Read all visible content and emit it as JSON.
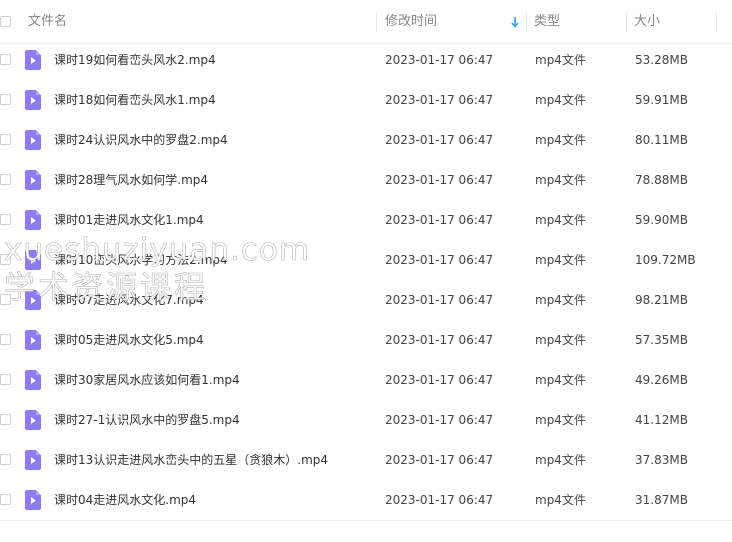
{
  "header": {
    "name_label": "文件名",
    "date_label": "修改时间",
    "type_label": "类型",
    "size_label": "大小",
    "sort_icon": "sort-down-arrow-icon"
  },
  "files": [
    {
      "name": "课时19如何看峦头风水2.mp4",
      "date": "2023-01-17 06:47",
      "type": "mp4文件",
      "size": "53.28MB"
    },
    {
      "name": "课时18如何看峦头风水1.mp4",
      "date": "2023-01-17 06:47",
      "type": "mp4文件",
      "size": "59.91MB"
    },
    {
      "name": "课时24认识风水中的罗盘2.mp4",
      "date": "2023-01-17 06:47",
      "type": "mp4文件",
      "size": "80.11MB"
    },
    {
      "name": "课时28理气风水如何学.mp4",
      "date": "2023-01-17 06:47",
      "type": "mp4文件",
      "size": "78.88MB"
    },
    {
      "name": "课时01走进风水文化1.mp4",
      "date": "2023-01-17 06:47",
      "type": "mp4文件",
      "size": "59.90MB"
    },
    {
      "name": "课时10峦头风水学习方法2.mp4",
      "date": "2023-01-17 06:47",
      "type": "mp4文件",
      "size": "109.72MB"
    },
    {
      "name": "课时07走进风水文化7.mp4",
      "date": "2023-01-17 06:47",
      "type": "mp4文件",
      "size": "98.21MB"
    },
    {
      "name": "课时05走进风水文化5.mp4",
      "date": "2023-01-17 06:47",
      "type": "mp4文件",
      "size": "57.35MB"
    },
    {
      "name": "课时30家居风水应该如何看1.mp4",
      "date": "2023-01-17 06:47",
      "type": "mp4文件",
      "size": "49.26MB"
    },
    {
      "name": "课时27-1认识风水中的罗盘5.mp4",
      "date": "2023-01-17 06:47",
      "type": "mp4文件",
      "size": "41.12MB"
    },
    {
      "name": "课时13认识走进风水峦头中的五星（贪狼木）.mp4",
      "date": "2023-01-17 06:47",
      "type": "mp4文件",
      "size": "37.83MB"
    },
    {
      "name": "课时04走进风水文化.mp4",
      "date": "2023-01-17 06:47",
      "type": "mp4文件",
      "size": "31.87MB"
    }
  ],
  "watermark": {
    "latin": "xueshuziyuan.com",
    "cjk": "学术资源课程"
  },
  "colors": {
    "file_icon": "#8b7cf6",
    "sort_arrow": "#1aa3ff",
    "header_text": "#888888",
    "row_text": "#333333"
  }
}
